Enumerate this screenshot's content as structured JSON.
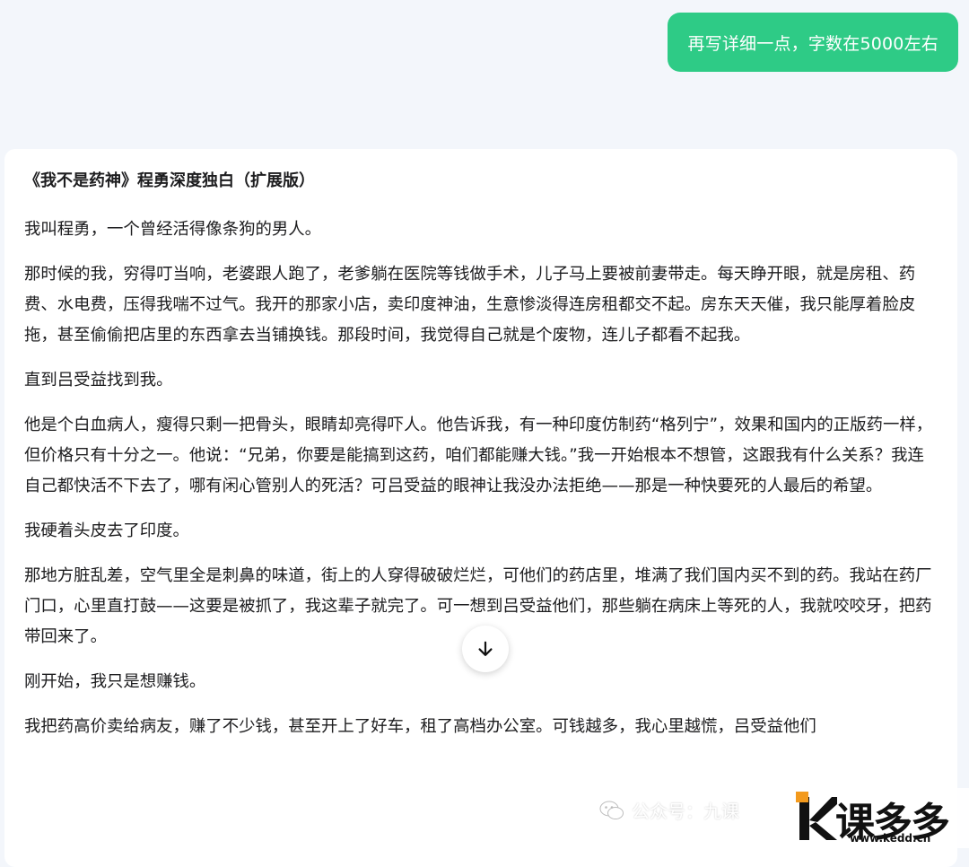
{
  "user_message": "再写详细一点，字数在5000左右",
  "answer": {
    "title": "《我不是药神》程勇深度独白（扩展版）",
    "paragraphs": [
      "我叫程勇，一个曾经活得像条狗的男人。",
      "那时候的我，穷得叮当响，老婆跟人跑了，老爹躺在医院等钱做手术，儿子马上要被前妻带走。每天睁开眼，就是房租、药费、水电费，压得我喘不过气。我开的那家小店，卖印度神油，生意惨淡得连房租都交不起。房东天天催，我只能厚着脸皮拖，甚至偷偷把店里的东西拿去当铺换钱。那段时间，我觉得自己就是个废物，连儿子都看不起我。",
      "直到吕受益找到我。",
      "他是个白血病人，瘦得只剩一把骨头，眼睛却亮得吓人。他告诉我，有一种印度仿制药“格列宁”，效果和国内的正版药一样，但价格只有十分之一。他说：“兄弟，你要是能搞到这药，咱们都能赚大钱。”我一开始根本不想管，这跟我有什么关系？我连自己都快活不下去了，哪有闲心管别人的死活？可吕受益的眼神让我没办法拒绝——那是一种快要死的人最后的希望。",
      "我硬着头皮去了印度。",
      "那地方脏乱差，空气里全是刺鼻的味道，街上的人穿得破破烂烂，可他们的药店里，堆满了我们国内买不到的药。我站在药厂门口，心里直打鼓——这要是被抓了，我这辈子就完了。可一想到吕受益他们，那些躺在病床上等死的人，我就咬咬牙，把药带回来了。",
      "刚开始，我只是想赚钱。",
      "我把药高价卖给病友，赚了不少钱，甚至开上了好车，租了高档办公室。可钱越多，我心里越慌，吕受益他们"
    ]
  },
  "watermark": {
    "wechat_text": "公众号：九课",
    "logo_text": "课多多",
    "logo_url": "www.kedd.cn"
  },
  "icons": {
    "scroll_down": "arrow-down-icon",
    "wechat": "wechat-icon"
  },
  "colors": {
    "user_bubble": "#2ecb86",
    "page_background": "#f3f6fb",
    "card_background": "#ffffff"
  }
}
